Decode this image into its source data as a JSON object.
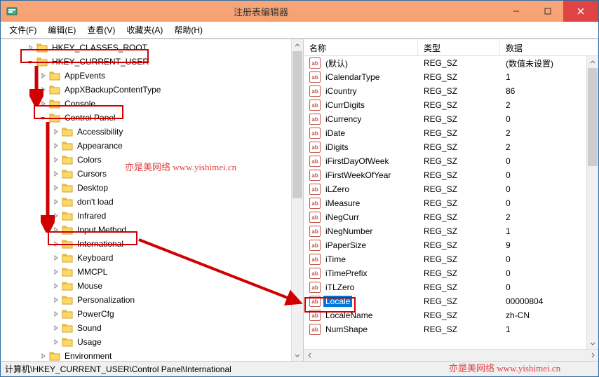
{
  "window": {
    "title": "注册表编辑器"
  },
  "menu": {
    "file": "文件(F)",
    "edit": "编辑(E)",
    "view": "查看(V)",
    "favorites": "收藏夹(A)",
    "help": "帮助(H)"
  },
  "tree": {
    "items": [
      {
        "indent": 2,
        "exp": "closed",
        "label": "HKEY_CLASSES_ROOT"
      },
      {
        "indent": 2,
        "exp": "open",
        "label": "HKEY_CURRENT_USER",
        "hl": true
      },
      {
        "indent": 3,
        "exp": "closed",
        "label": "AppEvents"
      },
      {
        "indent": 3,
        "exp": "closed",
        "label": "AppXBackupContentType"
      },
      {
        "indent": 3,
        "exp": "closed",
        "label": "Console"
      },
      {
        "indent": 3,
        "exp": "open",
        "label": "Control Panel",
        "hl": true
      },
      {
        "indent": 4,
        "exp": "closed",
        "label": "Accessibility"
      },
      {
        "indent": 4,
        "exp": "closed",
        "label": "Appearance"
      },
      {
        "indent": 4,
        "exp": "closed",
        "label": "Colors"
      },
      {
        "indent": 4,
        "exp": "closed",
        "label": "Cursors"
      },
      {
        "indent": 4,
        "exp": "closed",
        "label": "Desktop"
      },
      {
        "indent": 4,
        "exp": "closed",
        "label": "don't load"
      },
      {
        "indent": 4,
        "exp": "closed",
        "label": "Infrared"
      },
      {
        "indent": 4,
        "exp": "closed",
        "label": "Input Method"
      },
      {
        "indent": 4,
        "exp": "closed",
        "label": "International",
        "hl": true
      },
      {
        "indent": 4,
        "exp": "closed",
        "label": "Keyboard"
      },
      {
        "indent": 4,
        "exp": "closed",
        "label": "MMCPL"
      },
      {
        "indent": 4,
        "exp": "closed",
        "label": "Mouse"
      },
      {
        "indent": 4,
        "exp": "closed",
        "label": "Personalization"
      },
      {
        "indent": 4,
        "exp": "closed",
        "label": "PowerCfg"
      },
      {
        "indent": 4,
        "exp": "closed",
        "label": "Sound"
      },
      {
        "indent": 4,
        "exp": "closed",
        "label": "Usage"
      },
      {
        "indent": 3,
        "exp": "closed",
        "label": "Environment"
      }
    ]
  },
  "list": {
    "columns": {
      "name": "名称",
      "type": "类型",
      "data": "数据"
    },
    "rows": [
      {
        "name": "(默认)",
        "type": "REG_SZ",
        "data": "(数值未设置)"
      },
      {
        "name": "iCalendarType",
        "type": "REG_SZ",
        "data": "1"
      },
      {
        "name": "iCountry",
        "type": "REG_SZ",
        "data": "86"
      },
      {
        "name": "iCurrDigits",
        "type": "REG_SZ",
        "data": "2"
      },
      {
        "name": "iCurrency",
        "type": "REG_SZ",
        "data": "0"
      },
      {
        "name": "iDate",
        "type": "REG_SZ",
        "data": "2"
      },
      {
        "name": "iDigits",
        "type": "REG_SZ",
        "data": "2"
      },
      {
        "name": "iFirstDayOfWeek",
        "type": "REG_SZ",
        "data": "0"
      },
      {
        "name": "iFirstWeekOfYear",
        "type": "REG_SZ",
        "data": "0"
      },
      {
        "name": "iLZero",
        "type": "REG_SZ",
        "data": "0"
      },
      {
        "name": "iMeasure",
        "type": "REG_SZ",
        "data": "0"
      },
      {
        "name": "iNegCurr",
        "type": "REG_SZ",
        "data": "2"
      },
      {
        "name": "iNegNumber",
        "type": "REG_SZ",
        "data": "1"
      },
      {
        "name": "iPaperSize",
        "type": "REG_SZ",
        "data": "9"
      },
      {
        "name": "iTime",
        "type": "REG_SZ",
        "data": "0"
      },
      {
        "name": "iTimePrefix",
        "type": "REG_SZ",
        "data": "0"
      },
      {
        "name": "iTLZero",
        "type": "REG_SZ",
        "data": "0"
      },
      {
        "name": "Locale",
        "type": "REG_SZ",
        "data": "00000804",
        "selected": true,
        "hl": true
      },
      {
        "name": "LocaleName",
        "type": "REG_SZ",
        "data": "zh-CN"
      },
      {
        "name": "NumShape",
        "type": "REG_SZ",
        "data": "1"
      }
    ]
  },
  "statusbar": {
    "path": "计算机\\HKEY_CURRENT_USER\\Control Panel\\International"
  },
  "watermark": {
    "text": "亦是美网络  www.yishimei.cn"
  },
  "icons": {
    "ab": "ab"
  }
}
